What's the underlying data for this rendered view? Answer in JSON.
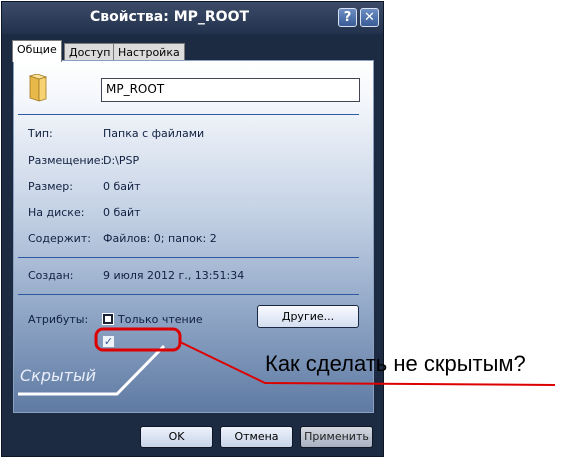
{
  "window": {
    "title": "Свойства: MP_ROOT",
    "help_label": "?",
    "close_label": "✕"
  },
  "tabs": [
    {
      "label": "Общие",
      "active": true
    },
    {
      "label": "Доступ",
      "active": false
    },
    {
      "label": "Настройка",
      "active": false
    }
  ],
  "general": {
    "folder_name": "MP_ROOT",
    "rows": [
      {
        "label": "Тип:",
        "value": "Папка с файлами"
      },
      {
        "label": "Размещение:",
        "value": "D:\\PSP"
      },
      {
        "label": "Размер:",
        "value": "0 байт"
      },
      {
        "label": "На диске:",
        "value": "0 байт"
      },
      {
        "label": "Содержит:",
        "value": "Файлов: 0; папок: 2"
      }
    ],
    "created_label": "Создан:",
    "created_value": "9 июля 2012 г., 13:51:34",
    "attributes_label": "Атрибуты:",
    "readonly_label": "Только чтение",
    "other_button": "Другие...",
    "hidden_label": "Скрытый"
  },
  "buttons": {
    "ok": "OK",
    "cancel": "Отмена",
    "apply": "Применить"
  },
  "annotation": {
    "question": "Как сделать не скрытым?",
    "color": "#dd0000"
  }
}
